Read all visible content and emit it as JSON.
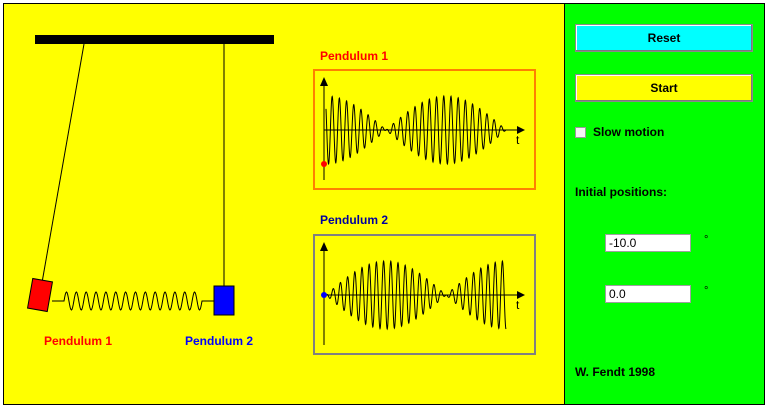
{
  "simulation": {
    "pendulum1_label": "Pendulum 1",
    "pendulum2_label": "Pendulum 2",
    "graph1_title": "Pendulum 1",
    "graph2_title": "Pendulum 2",
    "graph_axis_label": "t",
    "initial_angle_pendulum1_deg": -10.0,
    "initial_angle_pendulum2_deg": 0.0
  },
  "controls": {
    "reset_label": "Reset",
    "start_label": "Start",
    "slow_motion_label": "Slow motion",
    "slow_motion_checked": false,
    "initial_positions_label": "Initial positions:",
    "position1_value": "-10.0",
    "position2_value": "0.0",
    "degree_unit": "°",
    "author": "W. Fendt 1998"
  },
  "colors": {
    "canvas_background": "#ffff00",
    "panel_background": "#00ff00",
    "pendulum1": "#ff0000",
    "pendulum2": "#0000ff",
    "graph1_frame": "#ff8000",
    "graph2_frame": "#808080",
    "reset_button": "#00ffff",
    "start_button": "#ffff00",
    "graph1_title": "#ff0000",
    "graph2_title": "#0000a0"
  }
}
